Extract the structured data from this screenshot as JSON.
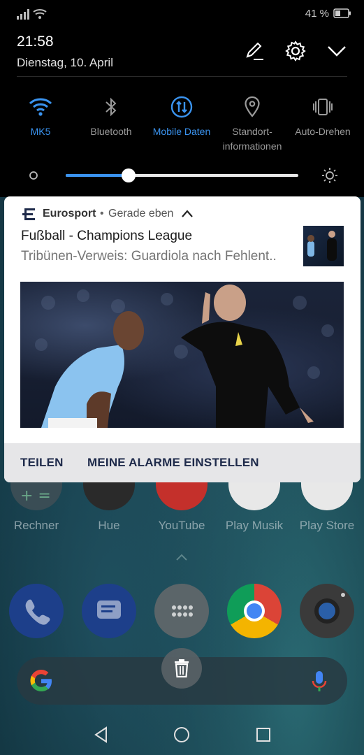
{
  "status_bar": {
    "battery_percent": "41 %",
    "battery_level": 0.41
  },
  "header": {
    "time": "21:58",
    "date": "Dienstag, 10. April",
    "icons": [
      "edit-icon",
      "settings-icon",
      "collapse-icon"
    ]
  },
  "quick_settings": {
    "tiles": [
      {
        "label": "MK5",
        "icon": "wifi-icon",
        "active": true
      },
      {
        "label": "Bluetooth",
        "icon": "bluetooth-icon",
        "active": false
      },
      {
        "label": "Mobile Daten",
        "icon": "mobile-data-icon",
        "active": true
      },
      {
        "label": "Standort-",
        "label2": "informationen",
        "icon": "location-icon",
        "active": false
      },
      {
        "label": "Auto-Drehen",
        "icon": "auto-rotate-icon",
        "active": false
      }
    ],
    "brightness_level": 0.27,
    "accent_color": "#3a93ef"
  },
  "notification": {
    "app_name": "Eurosport",
    "separator": "•",
    "time": "Gerade eben",
    "title": "Fußball - Champions League",
    "text": "Tribünen-Verweis: Guardiola nach Fehlent..",
    "actions": {
      "share": "TEILEN",
      "alarms": "MEINE ALARME EINSTELLEN"
    }
  },
  "home_screen": {
    "apps": [
      {
        "label": "Rechner",
        "icon": "calculator-icon"
      },
      {
        "label": "Hue",
        "icon": "hue-icon"
      },
      {
        "label": "YouTube",
        "icon": "youtube-icon"
      },
      {
        "label": "Play Musik",
        "icon": "play-music-icon"
      },
      {
        "label": "Play Store",
        "icon": "play-store-icon"
      }
    ],
    "dock": [
      "phone-icon",
      "messages-icon",
      "app-drawer-icon",
      "chrome-icon",
      "camera-icon"
    ]
  },
  "navigation": [
    "back-icon",
    "home-icon",
    "recents-icon"
  ]
}
